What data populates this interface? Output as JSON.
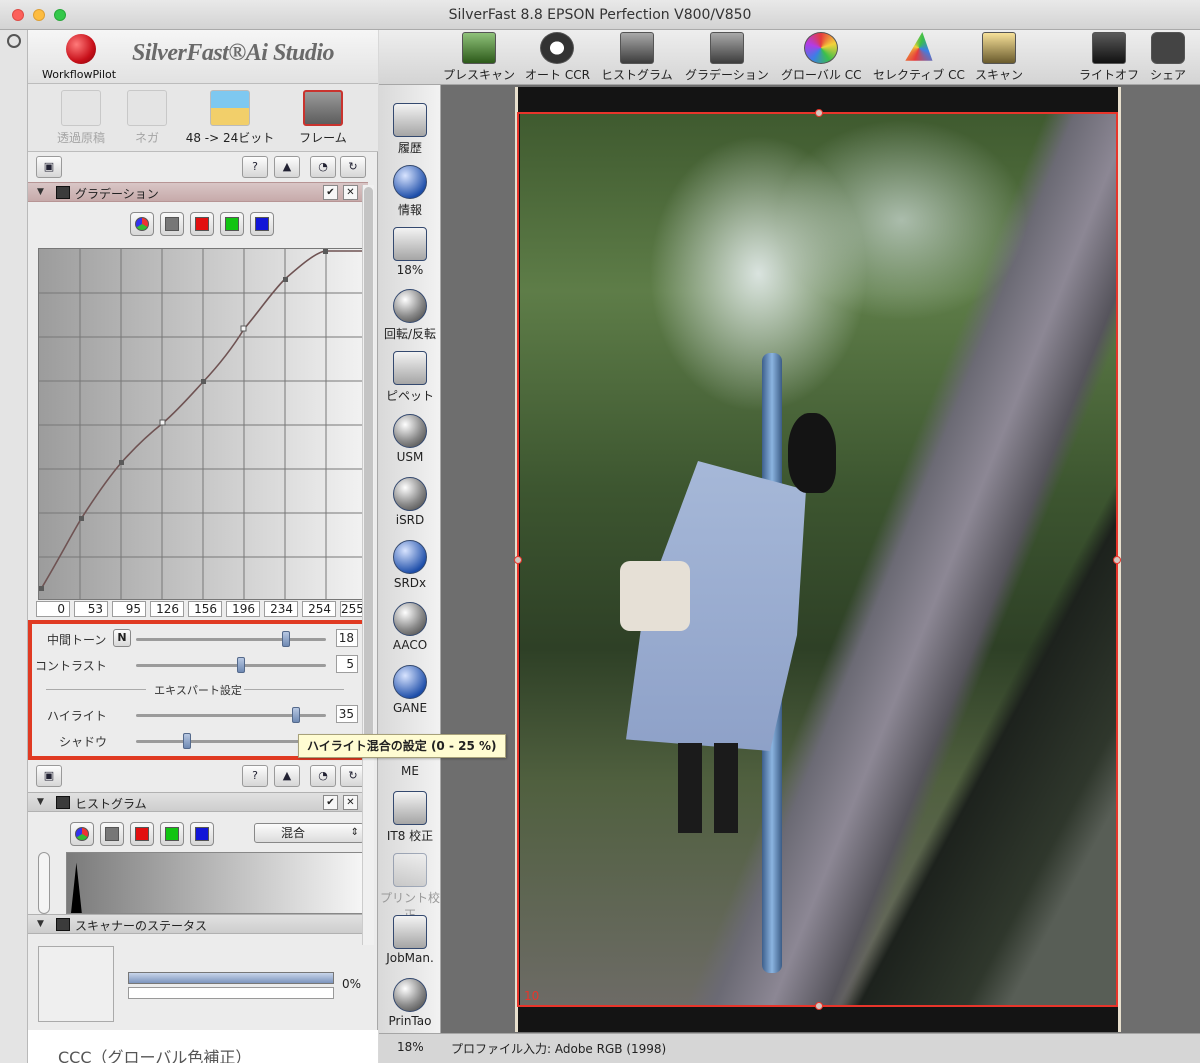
{
  "window": {
    "title": "SilverFast 8.8 EPSON Perfection V800/V850"
  },
  "brand": {
    "workflow": "WorkflowPilot",
    "product": "SilverFast®Ai Studio"
  },
  "modes": [
    {
      "label": "透過原稿",
      "state": "disabled"
    },
    {
      "label": "ネガ",
      "state": "disabled"
    },
    {
      "label": "48 -> 24ビット",
      "state": "enabled"
    },
    {
      "label": "フレーム",
      "state": "selected"
    }
  ],
  "top_toolbar": [
    {
      "label": "プレスキャン",
      "icon": "prescan-icon"
    },
    {
      "label": "オート CCR",
      "icon": "auto-ccr-icon"
    },
    {
      "label": "ヒストグラム",
      "icon": "histogram-icon"
    },
    {
      "label": "グラデーション",
      "icon": "gradation-icon"
    },
    {
      "label": "グローバル CC",
      "icon": "global-cc-icon"
    },
    {
      "label": "セレクティブ CC",
      "icon": "selective-cc-icon"
    },
    {
      "label": "スキャン",
      "icon": "scan-icon"
    },
    {
      "label": "ライトオフ",
      "icon": "lights-off-icon"
    },
    {
      "label": "シェア",
      "icon": "share-icon"
    }
  ],
  "tools": [
    {
      "label": "履歴",
      "icon": "history-icon",
      "enabled": true
    },
    {
      "label": "情報",
      "icon": "info-icon",
      "enabled": true
    },
    {
      "label": "18%",
      "icon": "zoom-icon",
      "enabled": true
    },
    {
      "label": "回転/反転",
      "icon": "rotate-icon",
      "enabled": true
    },
    {
      "label": "ピペット",
      "icon": "pipette-icon",
      "enabled": true
    },
    {
      "label": "USM",
      "icon": "usm-icon",
      "enabled": true
    },
    {
      "label": "iSRD",
      "icon": "isrd-icon",
      "enabled": true
    },
    {
      "label": "SRDx",
      "icon": "srdx-icon",
      "enabled": true
    },
    {
      "label": "AACO",
      "icon": "aaco-icon",
      "enabled": true
    },
    {
      "label": "GANE",
      "icon": "gane-icon",
      "enabled": true
    },
    {
      "label": "ME",
      "icon": "me-icon",
      "enabled": true
    },
    {
      "label": "IT8 校正",
      "icon": "it8-icon",
      "enabled": true
    },
    {
      "label": "プリント校正",
      "icon": "print-calibration-icon",
      "enabled": false
    },
    {
      "label": "JobMan.",
      "icon": "jobman-icon",
      "enabled": true
    },
    {
      "label": "PrinTao",
      "icon": "printao-icon",
      "enabled": true
    }
  ],
  "gradation": {
    "title": "グラデーション",
    "curve_values": [
      "0",
      "53",
      "95",
      "126",
      "156",
      "196",
      "234",
      "254",
      "255"
    ],
    "midtone": {
      "label": "中間トーン",
      "n_label": "N",
      "value": "18",
      "level": 0.79
    },
    "contrast": {
      "label": "コントラスト",
      "value": "5",
      "level": 0.55
    },
    "expert_label": "エキスパート設定",
    "highlight": {
      "label": "ハイライト",
      "value": "35",
      "level": 0.84
    },
    "shadow": {
      "label": "シャドウ",
      "value": "",
      "level": 0.27
    }
  },
  "tooltip": {
    "text": "ハイライト混合の設定 (0 - 25 %)"
  },
  "histogram": {
    "title": "ヒストグラム",
    "mode": "混合"
  },
  "scanner_status": {
    "title": "スキャナーのステータス",
    "progress": "0%"
  },
  "preview": {
    "frame_number": "10"
  },
  "statusbar": {
    "zoom": "18%",
    "profile": "プロファイル入力: Adobe RGB (1998)"
  },
  "page_fragment": {
    "text": "CCC（グローバル色補正）"
  }
}
